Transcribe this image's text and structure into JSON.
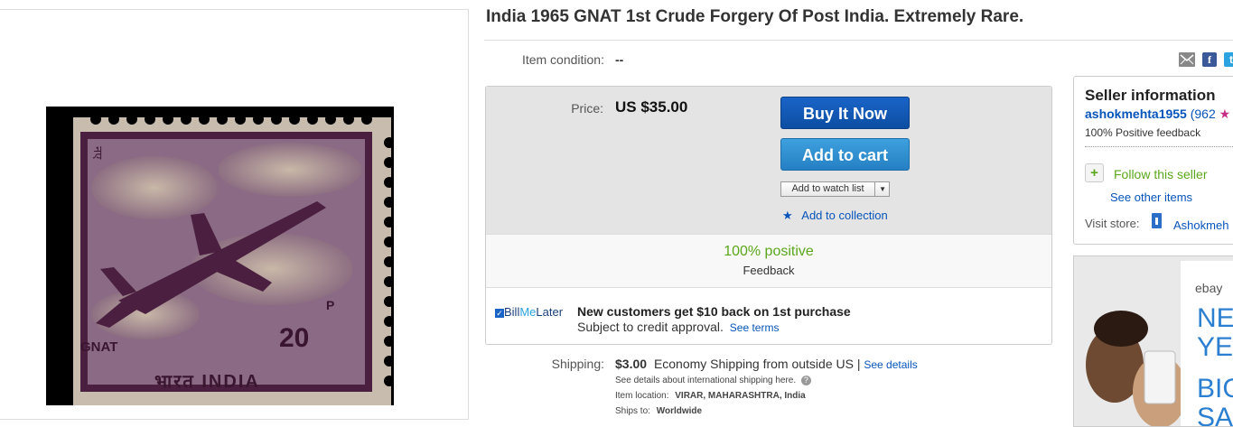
{
  "listing": {
    "title": "India 1965 GNAT 1st Crude Forgery Of Post India. Extremely Rare.",
    "condition_label": "Item condition:",
    "condition_value": "--"
  },
  "stamp": {
    "text_left": "GNAT",
    "text_bottom": "भारत INDIA",
    "denomination": "20",
    "denom_suffix": "P",
    "hindi_top": "नए"
  },
  "price": {
    "label": "Price:",
    "value": "US $35.00",
    "buy_label": "Buy It Now",
    "cart_label": "Add to cart",
    "watch_label": "Add to watch list",
    "collection_label": "Add to collection"
  },
  "feedback": {
    "percent": "100% positive",
    "label": "Feedback"
  },
  "billme": {
    "logo_bill": "Bill",
    "logo_me": "Me",
    "logo_later": "Later",
    "headline": "New customers get $10 back on 1st purchase",
    "sub": "Subject to credit approval.",
    "link": "See terms"
  },
  "shipping": {
    "label": "Shipping:",
    "cost": "$3.00",
    "desc": "Economy Shipping from outside US |",
    "details_link": "See details",
    "intl_note": "See details about international shipping here.",
    "location_label": "Item location:",
    "location_value": "VIRAR, MAHARASHTRA, India",
    "ships_label": "Ships to:",
    "ships_value": "Worldwide"
  },
  "seller": {
    "heading": "Seller information",
    "name": "ashokmehta1955",
    "score": "(962",
    "feedback": "100% Positive feedback",
    "follow": "Follow this seller",
    "other_items": "See other items",
    "visit_label": "Visit store:",
    "store_name": "Ashokmeh"
  },
  "ad": {
    "brand": "ebay",
    "line1": "NE",
    "line2": "YE",
    "line3": "BIG",
    "line4": "SA"
  },
  "colors": {
    "link": "#0654ba",
    "positive": "#5ba71b",
    "buy": "#0c4ea2",
    "cart": "#2580c3",
    "stamp_purple": "#5a2a4f"
  },
  "icons": [
    "email-icon",
    "facebook-icon",
    "twitter-icon",
    "star-icon",
    "plus-icon",
    "store-icon",
    "help-icon",
    "dropdown-arrow-icon"
  ]
}
